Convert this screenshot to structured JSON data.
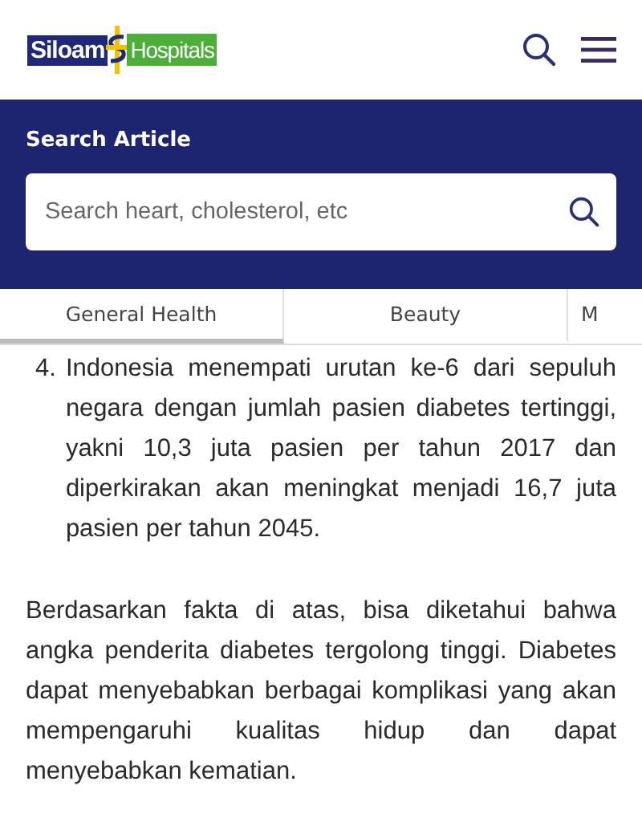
{
  "header": {
    "logo": {
      "left": "Siloam",
      "right": "Hospitals"
    }
  },
  "search_section": {
    "title": "Search Article",
    "search": {
      "placeholder": "Search heart, cholesterol, etc"
    }
  },
  "tabs": [
    {
      "label": "General Health",
      "selected": true
    },
    {
      "label": "Beauty",
      "selected": false
    },
    {
      "label": "M",
      "selected": false
    }
  ],
  "article": {
    "list_item": {
      "number": "4.",
      "text": "Indonesia menempati urutan ke-6 dari sepuluh negara dengan jumlah pasien diabetes tertinggi, yakni 10,3 juta pasien per tahun 2017 dan diperkirakan akan meningkat menjadi 16,7 juta pasien per tahun 2045."
    },
    "paragraph": "Berdasarkan fakta di atas, bisa diketahui bahwa angka penderita diabetes tergolong tinggi. Diabetes dapat menyebabkan berbagai komplikasi yang akan mempengaruhi kualitas hidup dan dapat menyebabkan kematian."
  }
}
